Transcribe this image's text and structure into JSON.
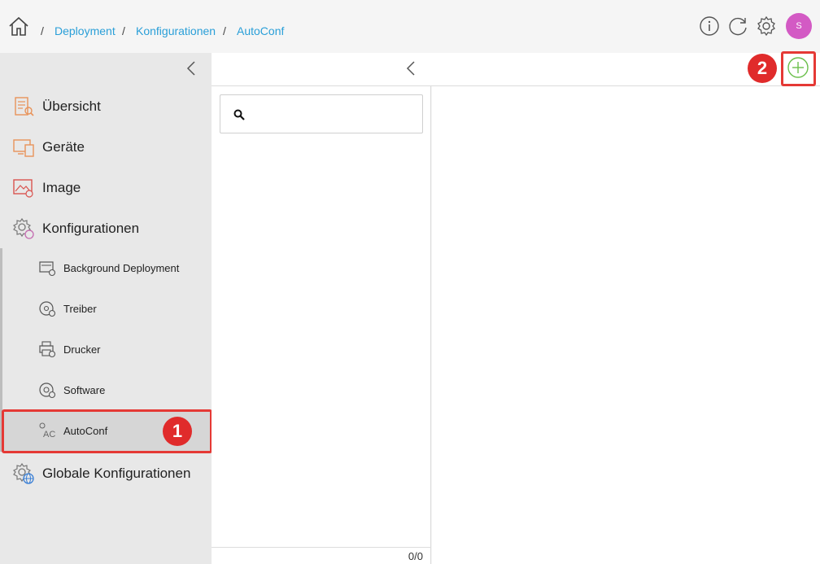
{
  "breadcrumb": {
    "items": [
      "Deployment",
      "Konfigurationen",
      "AutoConf"
    ],
    "separator": "/"
  },
  "header": {
    "icons": [
      "home-icon",
      "info-icon",
      "refresh-icon",
      "settings-icon"
    ],
    "avatar_initial": "S",
    "avatar_color": "#d35ac4"
  },
  "sidebar": {
    "items": [
      {
        "label": "Übersicht",
        "icon": "overview-icon"
      },
      {
        "label": "Geräte",
        "icon": "devices-icon"
      },
      {
        "label": "Image",
        "icon": "image-icon"
      },
      {
        "label": "Konfigurationen",
        "icon": "configurations-icon"
      }
    ],
    "subitems": [
      {
        "label": "Background Deployment",
        "icon": "background-deployment-icon"
      },
      {
        "label": "Treiber",
        "icon": "driver-icon"
      },
      {
        "label": "Drucker",
        "icon": "printer-icon"
      },
      {
        "label": "Software",
        "icon": "software-icon"
      },
      {
        "label": "AutoConf",
        "icon": "autoconf-icon",
        "active": true
      }
    ],
    "bottom_item": {
      "label": "Globale Konfigurationen",
      "icon": "global-configurations-icon"
    }
  },
  "annotations": {
    "badge1": "1",
    "badge2": "2"
  },
  "list": {
    "search_placeholder": "",
    "count": "0/0"
  },
  "colors": {
    "accent": "#2a9fd8",
    "highlight": "#e53935",
    "add": "#6abf4b"
  }
}
